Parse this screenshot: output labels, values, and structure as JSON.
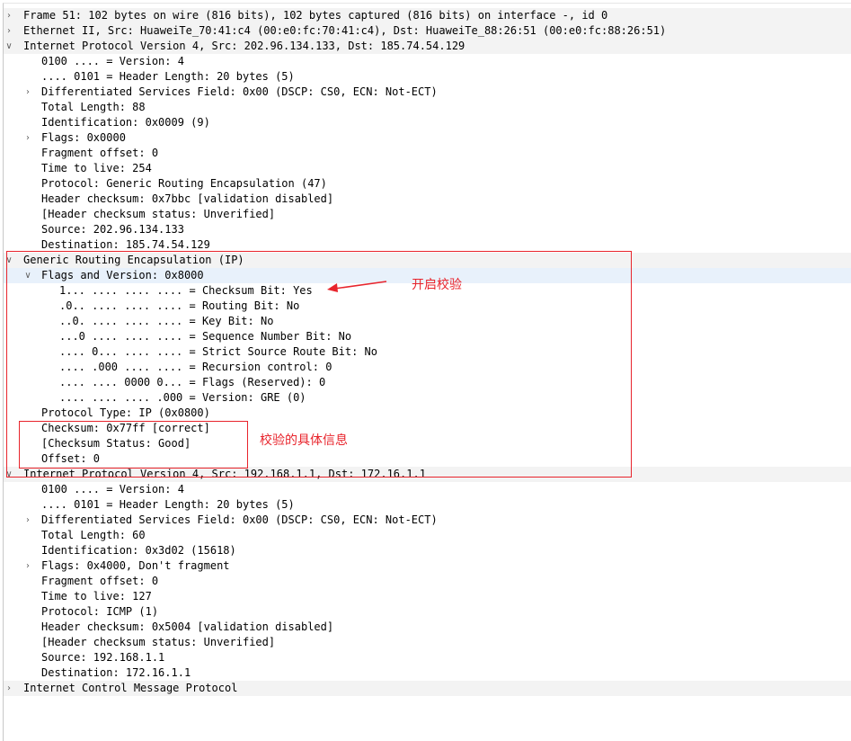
{
  "tree": [
    {
      "text": "Frame 51: 102 bytes on wire (816 bits), 102 bytes captured (816 bits) on interface -, id 0",
      "level": 0,
      "toggle": "collapsed",
      "style": "top"
    },
    {
      "text": "Ethernet II, Src: HuaweiTe_70:41:c4 (00:e0:fc:70:41:c4), Dst: HuaweiTe_88:26:51 (00:e0:fc:88:26:51)",
      "level": 0,
      "toggle": "collapsed",
      "style": "top"
    },
    {
      "text": "Internet Protocol Version 4, Src: 202.96.134.133, Dst: 185.74.54.129",
      "level": 0,
      "toggle": "expanded",
      "style": "top"
    },
    {
      "text": "0100 .... = Version: 4",
      "level": 1
    },
    {
      "text": ".... 0101 = Header Length: 20 bytes (5)",
      "level": 1
    },
    {
      "text": "Differentiated Services Field: 0x00 (DSCP: CS0, ECN: Not-ECT)",
      "level": 1,
      "toggle": "collapsed"
    },
    {
      "text": "Total Length: 88",
      "level": 1
    },
    {
      "text": "Identification: 0x0009 (9)",
      "level": 1
    },
    {
      "text": "Flags: 0x0000",
      "level": 1,
      "toggle": "collapsed"
    },
    {
      "text": "Fragment offset: 0",
      "level": 1
    },
    {
      "text": "Time to live: 254",
      "level": 1
    },
    {
      "text": "Protocol: Generic Routing Encapsulation (47)",
      "level": 1
    },
    {
      "text": "Header checksum: 0x7bbc [validation disabled]",
      "level": 1
    },
    {
      "text": "[Header checksum status: Unverified]",
      "level": 1
    },
    {
      "text": "Source: 202.96.134.133",
      "level": 1
    },
    {
      "text": "Destination: 185.74.54.129",
      "level": 1
    },
    {
      "text": "Generic Routing Encapsulation (IP)",
      "level": 0,
      "toggle": "expanded",
      "style": "top"
    },
    {
      "text": "Flags and Version: 0x8000",
      "level": 1,
      "toggle": "expanded",
      "style": "hl"
    },
    {
      "text": "1... .... .... .... = Checksum Bit: Yes",
      "level": 2
    },
    {
      "text": ".0.. .... .... .... = Routing Bit: No",
      "level": 2
    },
    {
      "text": "..0. .... .... .... = Key Bit: No",
      "level": 2
    },
    {
      "text": "...0 .... .... .... = Sequence Number Bit: No",
      "level": 2
    },
    {
      "text": ".... 0... .... .... = Strict Source Route Bit: No",
      "level": 2
    },
    {
      "text": ".... .000 .... .... = Recursion control: 0",
      "level": 2
    },
    {
      "text": ".... .... 0000 0... = Flags (Reserved): 0",
      "level": 2
    },
    {
      "text": ".... .... .... .000 = Version: GRE (0)",
      "level": 2
    },
    {
      "text": "Protocol Type: IP (0x0800)",
      "level": 1
    },
    {
      "text": "Checksum: 0x77ff [correct]",
      "level": 1
    },
    {
      "text": "[Checksum Status: Good]",
      "level": 1
    },
    {
      "text": "Offset: 0",
      "level": 1
    },
    {
      "text": "Internet Protocol Version 4, Src: 192.168.1.1, Dst: 172.16.1.1",
      "level": 0,
      "toggle": "expanded",
      "style": "top"
    },
    {
      "text": "0100 .... = Version: 4",
      "level": 1
    },
    {
      "text": ".... 0101 = Header Length: 20 bytes (5)",
      "level": 1
    },
    {
      "text": "Differentiated Services Field: 0x00 (DSCP: CS0, ECN: Not-ECT)",
      "level": 1,
      "toggle": "collapsed"
    },
    {
      "text": "Total Length: 60",
      "level": 1
    },
    {
      "text": "Identification: 0x3d02 (15618)",
      "level": 1
    },
    {
      "text": "Flags: 0x4000, Don't fragment",
      "level": 1,
      "toggle": "collapsed"
    },
    {
      "text": "Fragment offset: 0",
      "level": 1
    },
    {
      "text": "Time to live: 127",
      "level": 1
    },
    {
      "text": "Protocol: ICMP (1)",
      "level": 1
    },
    {
      "text": "Header checksum: 0x5004 [validation disabled]",
      "level": 1
    },
    {
      "text": "[Header checksum status: Unverified]",
      "level": 1
    },
    {
      "text": "Source: 192.168.1.1",
      "level": 1
    },
    {
      "text": "Destination: 172.16.1.1",
      "level": 1
    },
    {
      "text": "Internet Control Message Protocol",
      "level": 0,
      "toggle": "collapsed",
      "style": "top"
    }
  ],
  "annotations": {
    "checksum_enabled": "开启校验",
    "checksum_detail": "校验的具体信息"
  },
  "colors": {
    "annotation": "#e8242c",
    "highlight": "#e8f1fb",
    "top_level": "#f3f3f3"
  },
  "icons": {
    "collapsed": "chevron-right-icon",
    "expanded": "chevron-down-icon"
  }
}
